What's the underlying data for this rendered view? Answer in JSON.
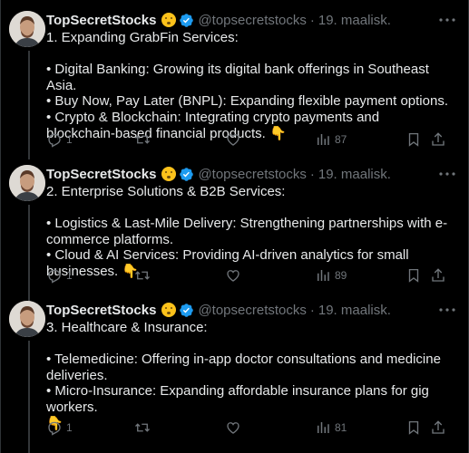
{
  "tweets": [
    {
      "name": "TopSecretStocks",
      "handle": "@topsecretstocks",
      "sep": "·",
      "date": "19. maalisk.",
      "text": "1. Expanding GrabFin Services:\n\n• Digital Banking: Growing its digital bank offerings in Southeast Asia.\n• Buy Now, Pay Later (BNPL): Expanding flexible payment options.\n• Crypto & Blockchain: Integrating crypto payments and blockchain-based financial products. 👇",
      "replies": "1",
      "views": "87"
    },
    {
      "name": "TopSecretStocks",
      "handle": "@topsecretstocks",
      "sep": "·",
      "date": "19. maalisk.",
      "text": "2. Enterprise Solutions & B2B Services:\n\n• Logistics & Last-Mile Delivery: Strengthening partnerships with e-commerce platforms.\n• Cloud & AI Services: Providing AI-driven analytics for small businesses. 👇",
      "replies": "1",
      "views": "89"
    },
    {
      "name": "TopSecretStocks",
      "handle": "@topsecretstocks",
      "sep": "·",
      "date": "19. maalisk.",
      "text": "3. Healthcare & Insurance:\n\n• Telemedicine: Offering in-app doctor consultations and medicine deliveries.\n• Micro-Insurance: Expanding affordable insurance plans for gig workers.\n👇",
      "replies": "1",
      "views": "81"
    }
  ],
  "icons": {
    "status_emoji": "shushing-face-icon",
    "verified": "verified-badge-icon",
    "more": "more-icon",
    "reply": "reply-icon",
    "retweet": "retweet-icon",
    "like": "like-icon",
    "views": "views-icon",
    "bookmark": "bookmark-icon",
    "share": "share-icon"
  },
  "colors": {
    "background": "#000000",
    "text": "#e7e9ea",
    "muted": "#71767b",
    "verified": "#1d9bf0",
    "divider": "#2f3336"
  }
}
